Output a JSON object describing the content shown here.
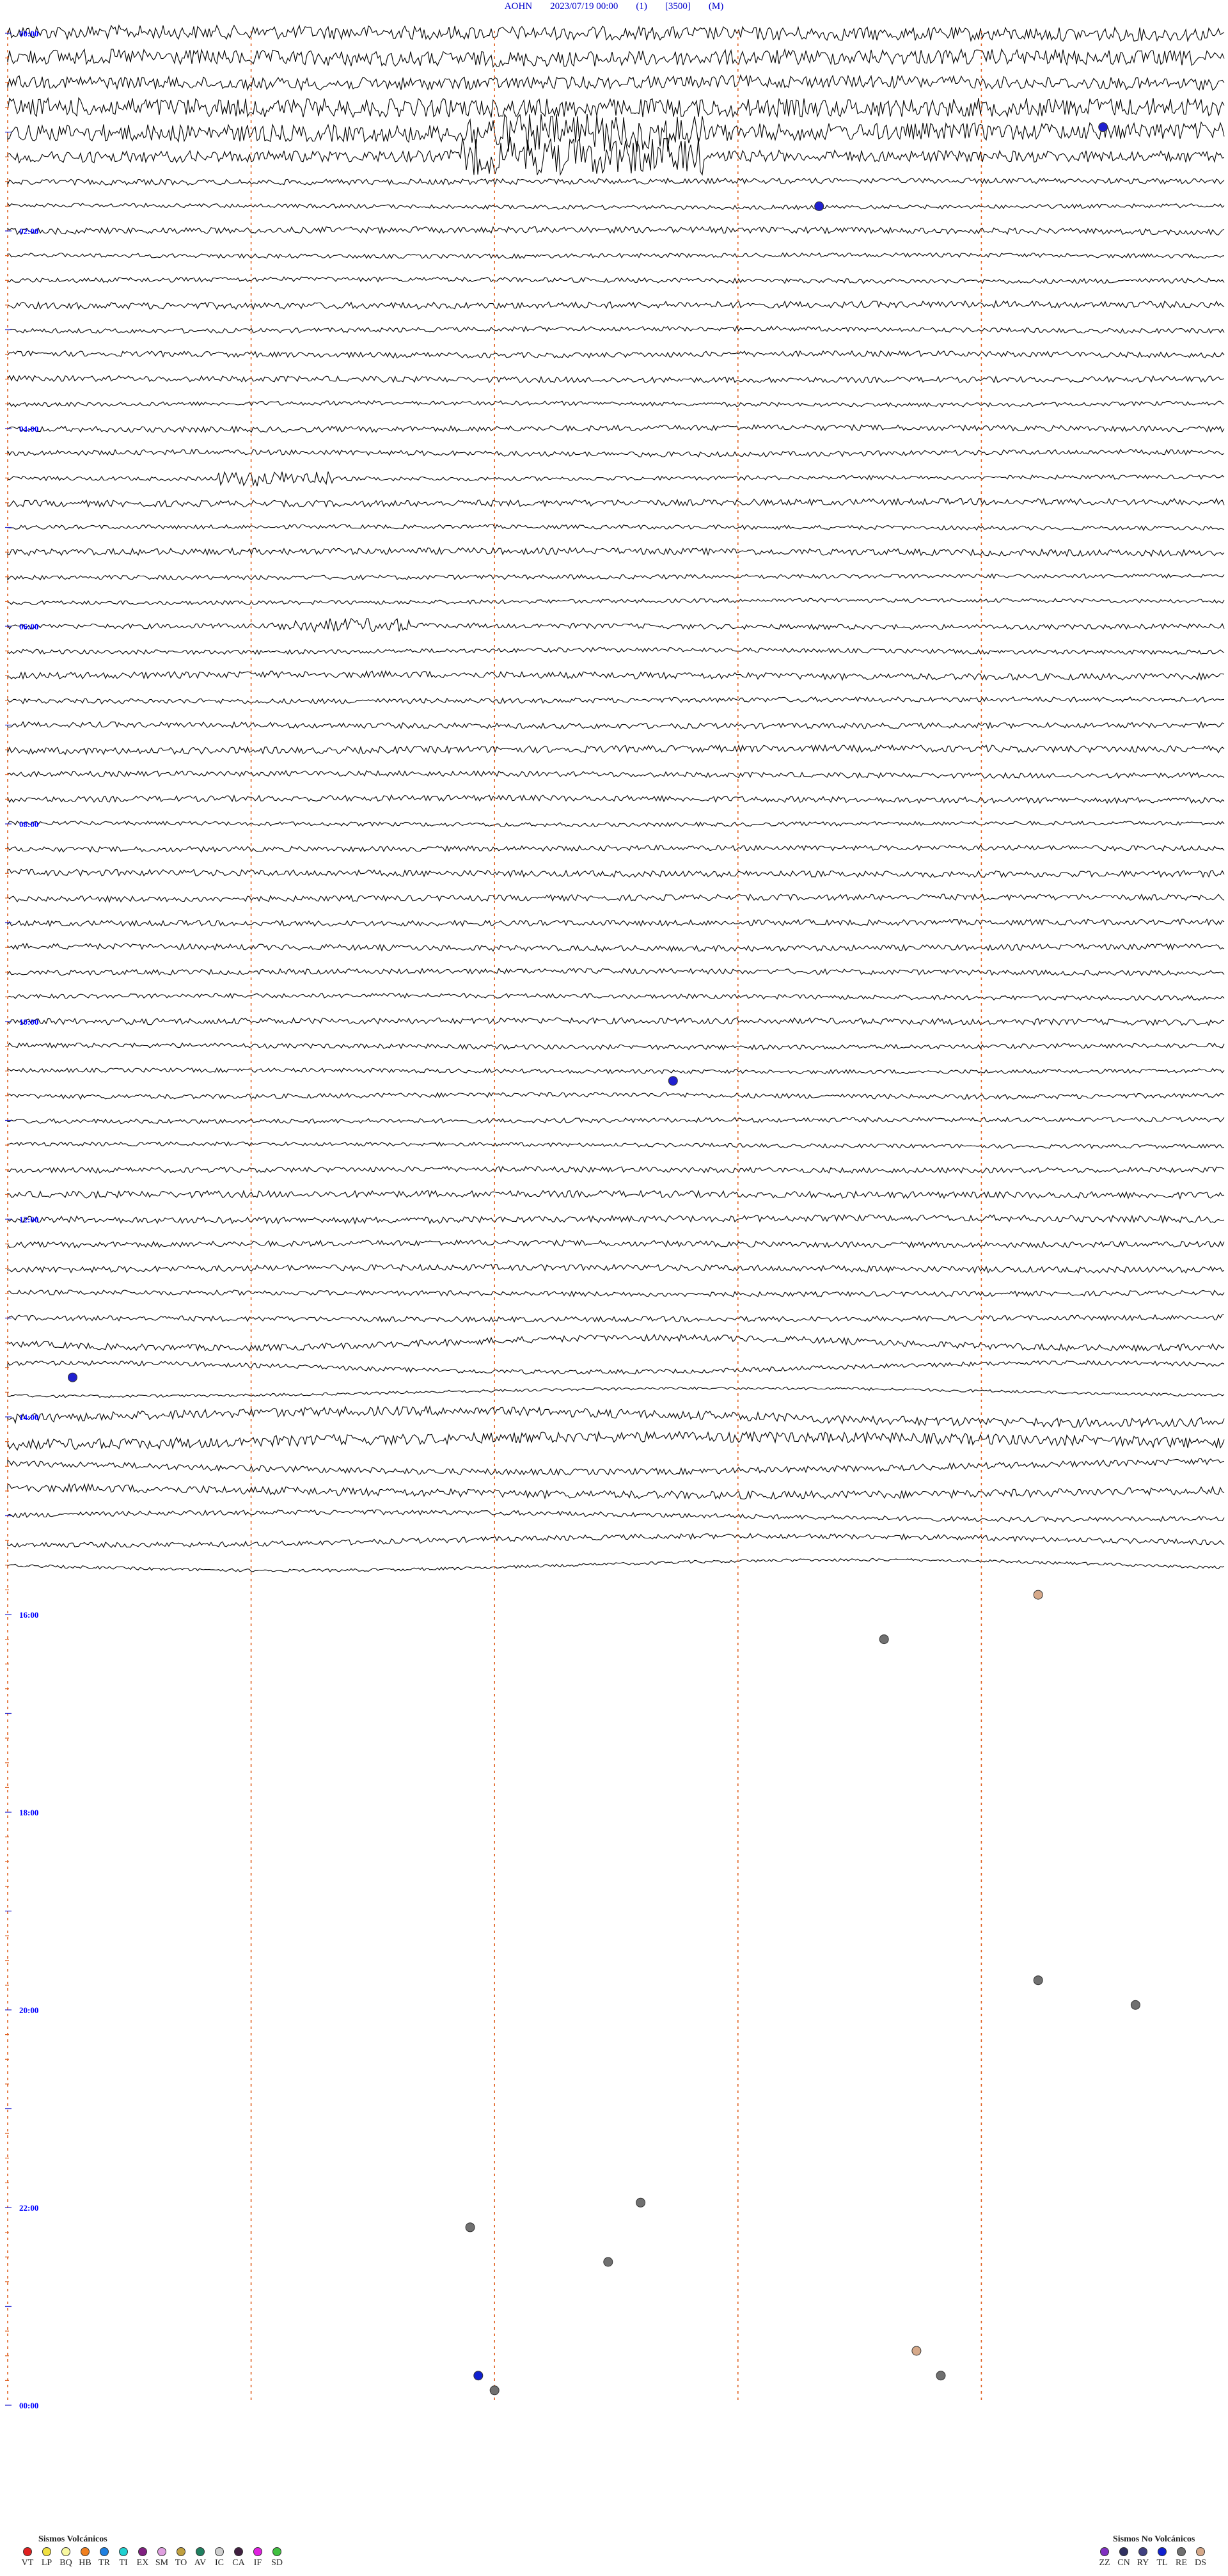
{
  "header": {
    "station": "AOHN",
    "datetime": "2023/07/19 00:00",
    "channel": "(1)",
    "scale": "[3500]",
    "mode": "(M)"
  },
  "chart_data": {
    "type": "helicorder",
    "start_time": "00:00",
    "end_time": "00:00",
    "hour_labels": [
      "00:00",
      "02:00",
      "04:00",
      "06:00",
      "08:00",
      "10:00",
      "12:00",
      "14:00",
      "16:00",
      "18:00",
      "20:00",
      "22:00",
      "00:00"
    ],
    "lines_per_hour": 4,
    "minutes_per_line": 15,
    "recorded_until_hour": 15.75,
    "trace_color": "#000000",
    "time_label_color": "#0000ff",
    "minute_marker_color": "#e06020",
    "events": [
      {
        "hour": 0.95,
        "minute": 13.5,
        "color": "#2020d0"
      },
      {
        "hour": 1.75,
        "minute": 10.0,
        "color": "#2020d0"
      },
      {
        "hour": 10.6,
        "minute": 8.2,
        "color": "#2020d0"
      },
      {
        "hour": 13.6,
        "minute": 0.8,
        "color": "#2020d0"
      },
      {
        "hour": 15.8,
        "minute": 12.7,
        "color": "#d6a98a"
      },
      {
        "hour": 16.25,
        "minute": 10.8,
        "color": "#707070"
      },
      {
        "hour": 19.7,
        "minute": 12.7,
        "color": "#707070"
      },
      {
        "hour": 19.95,
        "minute": 13.9,
        "color": "#707070"
      },
      {
        "hour": 21.2,
        "minute": 17.5,
        "color": "#1020d0"
      },
      {
        "hour": 21.95,
        "minute": 7.8,
        "color": "#707070"
      },
      {
        "hour": 22.2,
        "minute": 5.7,
        "color": "#707070"
      },
      {
        "hour": 22.55,
        "minute": 7.4,
        "color": "#707070"
      },
      {
        "hour": 23.45,
        "minute": 11.2,
        "color": "#d6a98a"
      },
      {
        "hour": 23.7,
        "minute": 11.5,
        "color": "#707070"
      },
      {
        "hour": 23.7,
        "minute": 5.8,
        "color": "#1020d0"
      },
      {
        "hour": 23.85,
        "minute": 6.0,
        "color": "#707070"
      }
    ]
  },
  "legend": {
    "volcanic_title": "Sismos Volcánicos",
    "volcanic": [
      {
        "code": "VT",
        "color": "#e02020"
      },
      {
        "code": "LP",
        "color": "#f0e040"
      },
      {
        "code": "BQ",
        "color": "#f8f8a0"
      },
      {
        "code": "HB",
        "color": "#f08020"
      },
      {
        "code": "TR",
        "color": "#2080e0"
      },
      {
        "code": "TI",
        "color": "#20d0d0"
      },
      {
        "code": "EX",
        "color": "#802080"
      },
      {
        "code": "SM",
        "color": "#e0a0e0"
      },
      {
        "code": "TO",
        "color": "#c0a040"
      },
      {
        "code": "AV",
        "color": "#208060"
      },
      {
        "code": "IC",
        "color": "#d0d0d0"
      },
      {
        "code": "CA",
        "color": "#402040"
      },
      {
        "code": "IF",
        "color": "#e020e0"
      },
      {
        "code": "SD",
        "color": "#40c040"
      }
    ],
    "non_volcanic_title": "Sismos No Volcánicos",
    "non_volcanic": [
      {
        "code": "ZZ",
        "color": "#8030c0"
      },
      {
        "code": "CN",
        "color": "#303060"
      },
      {
        "code": "RY",
        "color": "#404080"
      },
      {
        "code": "TL",
        "color": "#1020d0"
      },
      {
        "code": "RE",
        "color": "#707070"
      },
      {
        "code": "DS",
        "color": "#d6a98a"
      }
    ]
  }
}
